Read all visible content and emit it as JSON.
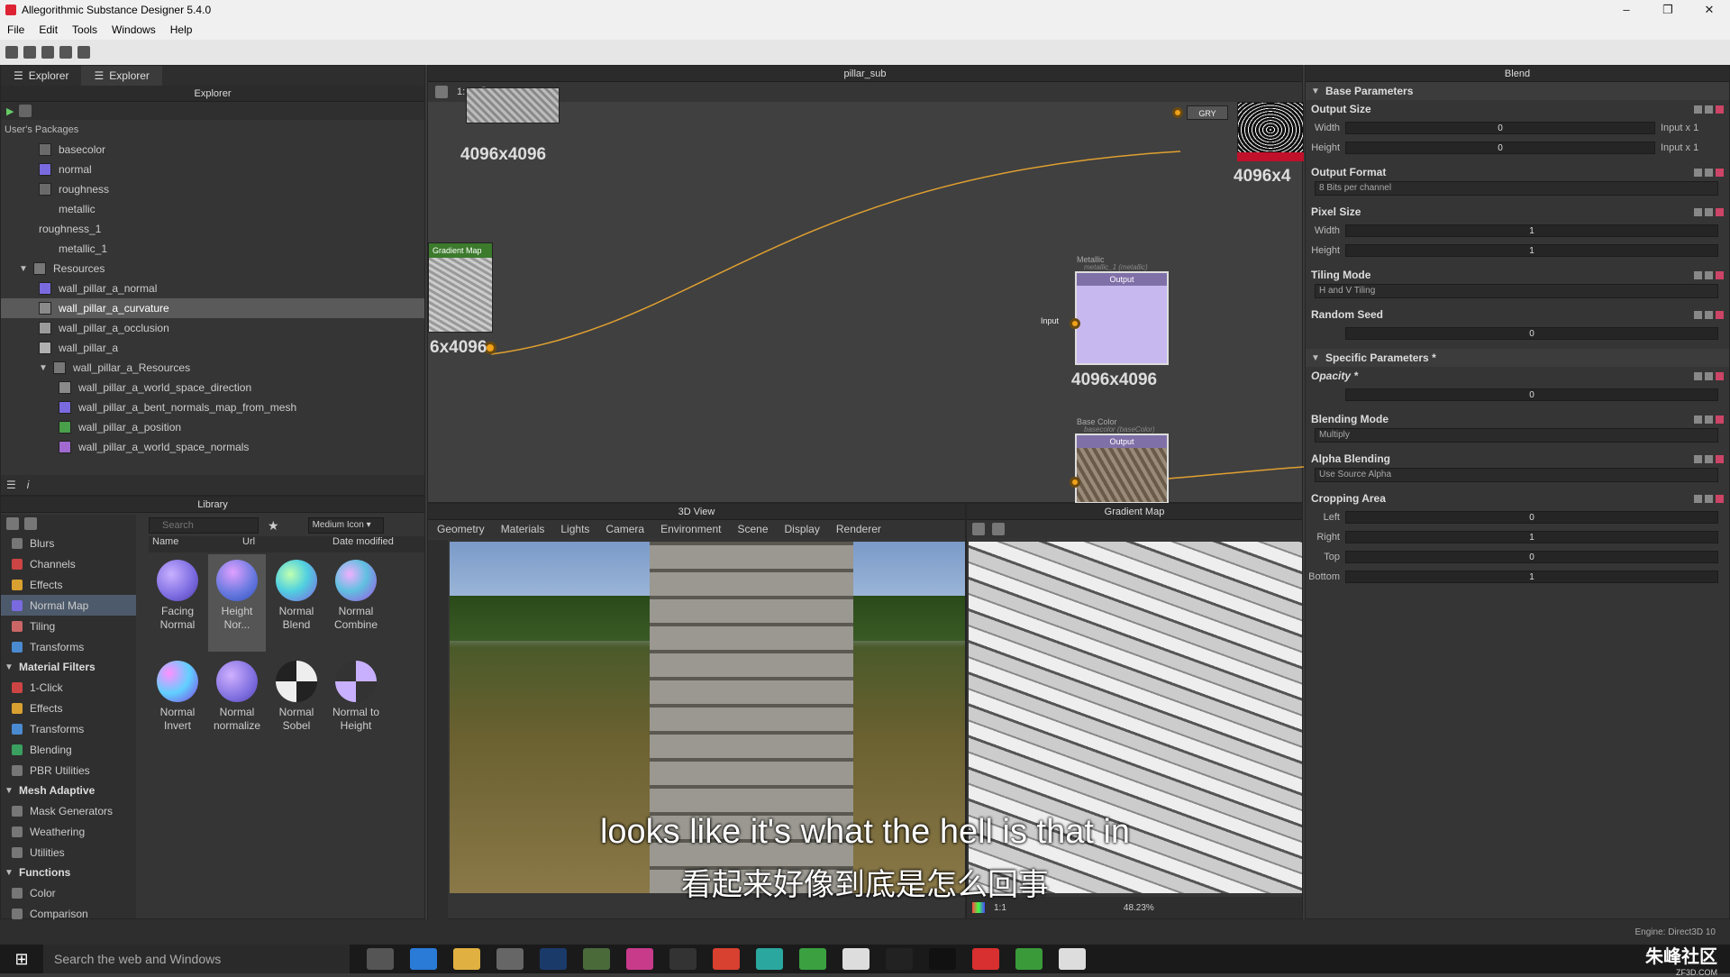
{
  "window": {
    "title": "Allegorithmic Substance Designer 5.4.0",
    "min": "–",
    "max": "❐",
    "close": "✕"
  },
  "menu": [
    "File",
    "Edit",
    "Tools",
    "Windows",
    "Help"
  ],
  "explorer": {
    "tabs": [
      "Explorer",
      "Explorer"
    ],
    "header": "Explorer",
    "root": "User's Packages",
    "items": [
      {
        "label": "basecolor",
        "indent": 1,
        "color": "#6a6a6a"
      },
      {
        "label": "normal",
        "indent": 1,
        "color": "#7a6ae0"
      },
      {
        "label": "roughness",
        "indent": 1,
        "color": "#6a6a6a"
      },
      {
        "label": "metallic",
        "indent": 1,
        "color": ""
      },
      {
        "label": "roughness_1",
        "indent": 0,
        "color": ""
      },
      {
        "label": "metallic_1",
        "indent": 1,
        "color": ""
      },
      {
        "label": "Resources",
        "indent": 0,
        "folder": true
      },
      {
        "label": "wall_pillar_a_normal",
        "indent": 1,
        "color": "#7a6ae0"
      },
      {
        "label": "wall_pillar_a_curvature",
        "indent": 1,
        "color": "#8a8a8a",
        "selected": true
      },
      {
        "label": "wall_pillar_a_occlusion",
        "indent": 1,
        "color": "#9a9a9a"
      },
      {
        "label": "wall_pillar_a",
        "indent": 1,
        "color": "#b0b0b0"
      },
      {
        "label": "wall_pillar_a_Resources",
        "indent": 1,
        "folder": true
      },
      {
        "label": "wall_pillar_a_world_space_direction",
        "indent": 2,
        "color": "#8a8a8a"
      },
      {
        "label": "wall_pillar_a_bent_normals_map_from_mesh",
        "indent": 2,
        "color": "#7a6ae0"
      },
      {
        "label": "wall_pillar_a_position",
        "indent": 2,
        "color": "#4aa04a"
      },
      {
        "label": "wall_pillar_a_world_space_normals",
        "indent": 2,
        "color": "#a06ad0"
      }
    ]
  },
  "library": {
    "header": "Library",
    "search_placeholder": "Search",
    "view_mode": "Medium Icon",
    "columns": [
      "Name",
      "Url",
      "Date modified"
    ],
    "categories": [
      {
        "label": "Blurs",
        "type": "item",
        "color": "#777"
      },
      {
        "label": "Channels",
        "type": "item",
        "color": "#c44"
      },
      {
        "label": "Effects",
        "type": "item",
        "color": "#d8a030"
      },
      {
        "label": "Normal Map",
        "type": "item",
        "color": "#7a6ae0",
        "selected": true
      },
      {
        "label": "Tiling",
        "type": "item",
        "color": "#c66"
      },
      {
        "label": "Transforms",
        "type": "item",
        "color": "#4a8ad0"
      },
      {
        "label": "Material Filters",
        "type": "header"
      },
      {
        "label": "1-Click",
        "type": "item",
        "color": "#c44"
      },
      {
        "label": "Effects",
        "type": "item",
        "color": "#d8a030"
      },
      {
        "label": "Transforms",
        "type": "item",
        "color": "#4a8ad0"
      },
      {
        "label": "Blending",
        "type": "item",
        "color": "#3aa060"
      },
      {
        "label": "PBR Utilities",
        "type": "item",
        "color": "#777"
      },
      {
        "label": "Mesh Adaptive",
        "type": "header"
      },
      {
        "label": "Mask Generators",
        "type": "item",
        "color": "#777"
      },
      {
        "label": "Weathering",
        "type": "item",
        "color": "#777"
      },
      {
        "label": "Utilities",
        "type": "item",
        "color": "#777"
      },
      {
        "label": "Functions",
        "type": "header"
      },
      {
        "label": "Color",
        "type": "item",
        "color": "#777"
      },
      {
        "label": "Comparison",
        "type": "item",
        "color": "#777"
      }
    ],
    "items": [
      {
        "label": "Facing Normal",
        "grad": "radial-gradient(circle at 35% 35%,#c8b0ff,#7a6ae0 60%,#4a3aa0)"
      },
      {
        "label": "Height Nor...",
        "grad": "radial-gradient(circle at 40% 30%,#e0a0ff,#6a7ae0 55%,#3050c0)",
        "selected": true
      },
      {
        "label": "Normal Blend",
        "grad": "radial-gradient(circle at 35% 35%,#c0ffb0,#50d0e0 45%,#8060e0)"
      },
      {
        "label": "Normal Combine",
        "grad": "radial-gradient(circle at 35% 35%,#f0b0ff,#60c0e0 45%,#a050e0)"
      },
      {
        "label": "Normal Invert",
        "grad": "radial-gradient(circle at 30% 30%,#ff90ff,#60d0ff 50%,#8040e0)"
      },
      {
        "label": "Normal normalize",
        "grad": "radial-gradient(circle at 35% 35%,#d0b0ff,#8070e0 60%,#5040b0)"
      },
      {
        "label": "Normal Sobel",
        "grad": "repeating-conic-gradient(#eee 0 25%,#222 0 50%)"
      },
      {
        "label": "Normal to Height",
        "grad": "repeating-conic-gradient(#c8b0ff 0 25%,#333 0 50%)"
      }
    ]
  },
  "graph": {
    "title": "pillar_sub",
    "zoom_label": "1:1",
    "nodes": [
      {
        "size": "4096x4096",
        "title": ""
      },
      {
        "size": "6x4096",
        "title": "Gradient Map"
      },
      {
        "size": "4096x4096",
        "title": "Output",
        "caption": "Metallic",
        "subcaption": "metallic_1 (metallic)"
      },
      {
        "size": "",
        "title": "Output",
        "caption": "Base Color",
        "subcaption": "basecolor (baseColor)"
      },
      {
        "size": "4096x4",
        "title": "GRY"
      }
    ],
    "input_label": "Input"
  },
  "view3d": {
    "header": "3D View",
    "tabs": [
      "Geometry",
      "Materials",
      "Lights",
      "Camera",
      "Environment",
      "Scene",
      "Display",
      "Renderer"
    ]
  },
  "view2d": {
    "header": "Gradient Map",
    "zoom": "48.23%",
    "ratio": "1:1"
  },
  "subtitles": {
    "en": "looks like it's what the hell is that in",
    "zh": "看起来好像到底是怎么回事"
  },
  "properties": {
    "header": "Blend",
    "sections": [
      {
        "group": "Base Parameters",
        "collapsible": true
      },
      {
        "group": "Output Size",
        "rows": [
          {
            "label": "Width",
            "value": "0",
            "suffix": "Input x 1"
          },
          {
            "label": "Height",
            "value": "0",
            "suffix": "Input x 1"
          }
        ]
      },
      {
        "group": "Output Format",
        "combo": "8 Bits per channel"
      },
      {
        "group": "Pixel Size",
        "rows": [
          {
            "label": "Width",
            "value": "1"
          },
          {
            "label": "Height",
            "value": "1"
          }
        ]
      },
      {
        "group": "Tiling Mode",
        "combo": "H and V Tiling"
      },
      {
        "group": "Random Seed",
        "rows": [
          {
            "label": "",
            "value": "0"
          }
        ]
      },
      {
        "group": "Specific Parameters *",
        "collapsible": true
      },
      {
        "group": "Opacity *",
        "italic": true,
        "rows": [
          {
            "label": "",
            "value": "0"
          }
        ]
      },
      {
        "group": "Blending Mode",
        "combo": "Multiply"
      },
      {
        "group": "Alpha Blending",
        "combo": "Use Source Alpha"
      },
      {
        "group": "Cropping Area",
        "rows": [
          {
            "label": "Left",
            "value": "0"
          },
          {
            "label": "Right",
            "value": "1"
          },
          {
            "label": "Top",
            "value": "0"
          },
          {
            "label": "Bottom",
            "value": "1"
          }
        ]
      }
    ]
  },
  "status": {
    "engine": "Engine: Direct3D 10"
  },
  "taskbar": {
    "search": "Search the web and Windows",
    "watermark": "朱峰社区",
    "clock": "ZF3D.COM"
  }
}
